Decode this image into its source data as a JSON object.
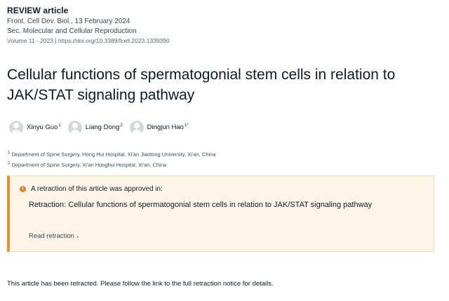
{
  "article": {
    "type": "REVIEW article",
    "journal_line": "Front. Cell Dev. Biol., 13 February 2024",
    "section": "Sec. Molecular and Cellular Reproduction",
    "volume_doi": "Volume 11 - 2023 | https://doi.org/10.3389/fcell.2023.1339390",
    "title": "Cellular functions of spermatogonial stem cells in relation to JAK/STAT signaling pathway"
  },
  "authors": [
    {
      "name": "Xinyu Guo",
      "sup": "1"
    },
    {
      "name": "Liang Dong",
      "sup": "2"
    },
    {
      "name": "Dingjun Hao",
      "sup": "1*"
    }
  ],
  "affiliations": [
    {
      "sup": "1",
      "text": "Department of Spine Surgery, Hong Hui Hospital, Xi'an Jiaotong University, Xi'an, China"
    },
    {
      "sup": "2",
      "text": "Department of Spine Surgery, Xi'an Honghui Hospital, Xi'an, China"
    }
  ],
  "notice": {
    "icon": "warning-icon",
    "heading": "A retraction of this article was approved in:",
    "link_text": "Retraction: Cellular functions of spermatogonial stem cells in relation to JAK/STAT signaling pathway",
    "read_link": "Read retraction",
    "accent_color": "#e8902e",
    "bg_color": "#fef5e8"
  },
  "retracted_message": "This article has been retracted. Please follow the link to the full retraction notice for details."
}
